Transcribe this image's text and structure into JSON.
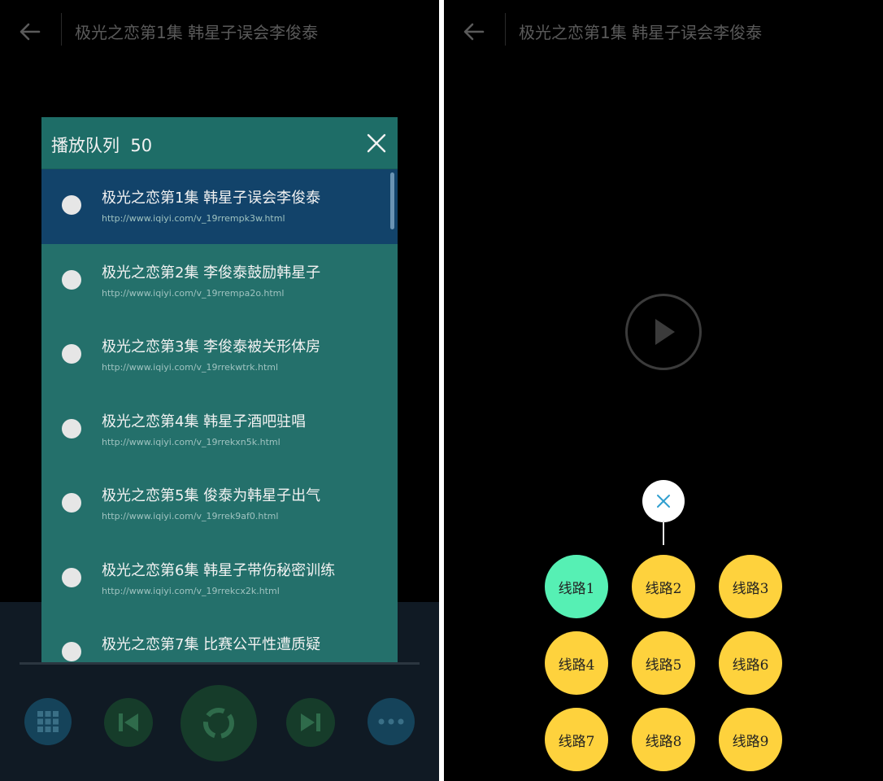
{
  "top_bar": {
    "title": "极光之恋第1集 韩星子误会李俊泰"
  },
  "queue": {
    "title": "播放队列",
    "count": "50",
    "items": [
      {
        "title": "极光之恋第1集 韩星子误会李俊泰",
        "url": "http://www.iqiyi.com/v_19rrempk3w.html",
        "selected": true
      },
      {
        "title": "极光之恋第2集 李俊泰鼓励韩星子",
        "url": "http://www.iqiyi.com/v_19rrempa2o.html"
      },
      {
        "title": "极光之恋第3集 李俊泰被关形体房",
        "url": "http://www.iqiyi.com/v_19rrekwtrk.html"
      },
      {
        "title": "极光之恋第4集 韩星子酒吧驻唱",
        "url": "http://www.iqiyi.com/v_19rrekxn5k.html"
      },
      {
        "title": "极光之恋第5集 俊泰为韩星子出气",
        "url": "http://www.iqiyi.com/v_19rrek9af0.html"
      },
      {
        "title": "极光之恋第6集 韩星子带伤秘密训练",
        "url": "http://www.iqiyi.com/v_19rrekcx2k.html"
      },
      {
        "title": "极光之恋第7集 比赛公平性遭质疑",
        "url": ""
      }
    ]
  },
  "routes": {
    "active_index": 0,
    "items": [
      "线路1",
      "线路2",
      "线路3",
      "线路4",
      "线路5",
      "线路6",
      "线路7",
      "线路8",
      "线路9"
    ]
  },
  "colors": {
    "queue_bg": "#24706b",
    "queue_selected": "#12436a",
    "route_default": "#fed23d",
    "route_active": "#56f0b4",
    "close_accent": "#2f9fcf"
  },
  "icons": {
    "back": "arrow-left-icon",
    "close": "close-icon",
    "play": "play-icon",
    "grid": "grid-icon",
    "prev": "skip-previous-icon",
    "next": "skip-next-icon",
    "more": "more-dots-icon"
  }
}
